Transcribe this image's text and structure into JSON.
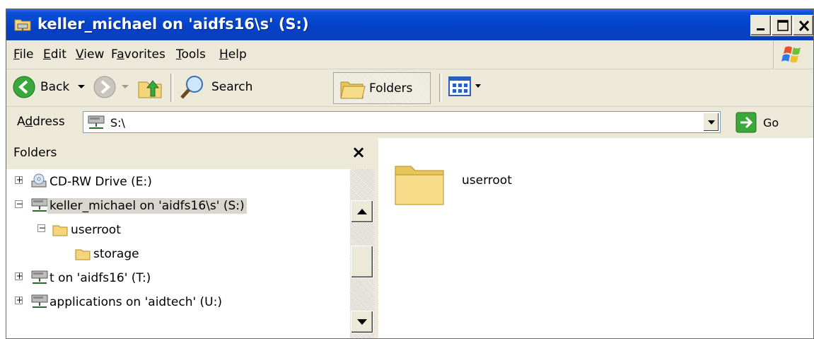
{
  "window": {
    "title": "keller_michael on 'aidfs16\\s' (S:)",
    "title_icon": "network-folder-icon",
    "buttons": [
      "minimize-icon",
      "maximize-icon",
      "close-icon"
    ]
  },
  "menu": {
    "items": [
      {
        "key": "F",
        "rest": "ile"
      },
      {
        "key": "E",
        "rest": "dit"
      },
      {
        "key": "V",
        "rest": "iew"
      },
      {
        "pre": "F",
        "key": "a",
        "rest": "vorites"
      },
      {
        "key": "T",
        "rest": "ools"
      },
      {
        "key": "H",
        "rest": "elp"
      }
    ]
  },
  "toolbar": {
    "back_label": "Back",
    "search_label": "Search",
    "folders_label": "Folders"
  },
  "address": {
    "label_pre": "A",
    "label_key": "d",
    "label_rest": "dress",
    "value": "S:\\",
    "go_label": "Go"
  },
  "folders_pane": {
    "title": "Folders",
    "items": [
      {
        "label": "CD-RW Drive (E:)",
        "icon": "cd-drive-icon",
        "expander": "+"
      },
      {
        "label": "keller_michael on 'aidfs16\\s' (S:)",
        "icon": "network-drive-icon",
        "expander": "−",
        "selected": true
      },
      {
        "label": "userroot",
        "icon": "folder-icon",
        "expander": "−"
      },
      {
        "label": "storage",
        "icon": "folder-icon"
      },
      {
        "label": "t on 'aidfs16' (T:)",
        "icon": "network-drive-icon",
        "expander": "+"
      },
      {
        "label": "applications on 'aidtech' (U:)",
        "icon": "network-drive-icon",
        "expander": "+"
      }
    ]
  },
  "content": {
    "items": [
      {
        "label": "userroot",
        "icon": "large-folder-icon"
      }
    ]
  },
  "colors": {
    "title_blue": "#0441c9",
    "chrome": "#ece9d8",
    "selection": "#d8d6ce"
  }
}
